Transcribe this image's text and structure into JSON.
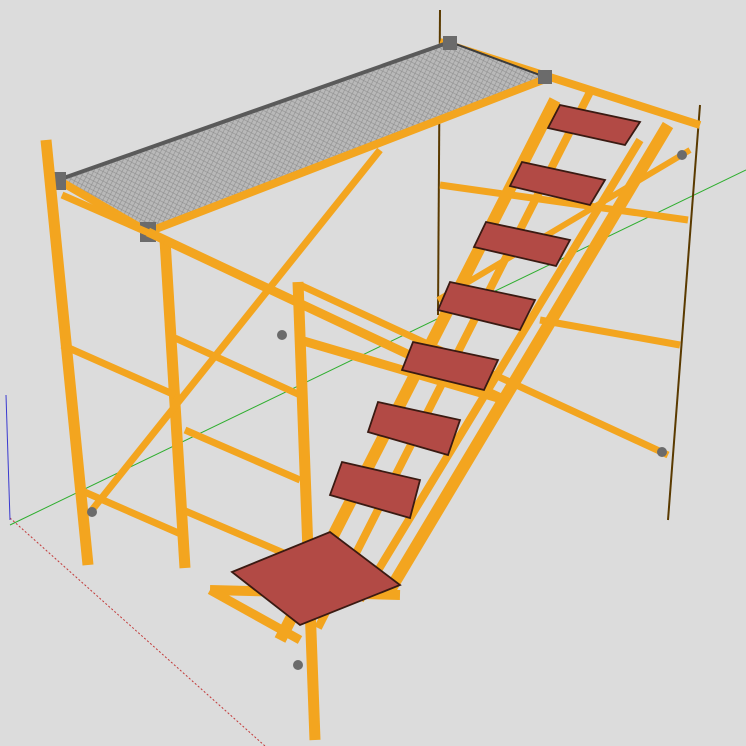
{
  "scene": {
    "description_visible_text": "",
    "colors": {
      "background": "#dcdcdc",
      "frame_orange": "#f3a51f",
      "frame_edge": "#5a3a00",
      "tread_red": "#b24a45",
      "tread_top": "#c55a55",
      "deck_mesh": "#b9b9b9",
      "deck_mesh_dark": "#8c8c8c",
      "clamp": "#6b6b6b",
      "axis_green": "#2fae2f",
      "axis_red": "#c23a3a",
      "axis_blue": "#3a3ad0"
    },
    "objects": [
      "scaffold-frame",
      "mesh-deck-platform",
      "stair-stringer",
      "stair-treads",
      "cross-braces",
      "frame-clamps",
      "axis-lines"
    ],
    "tread_count": 8
  }
}
